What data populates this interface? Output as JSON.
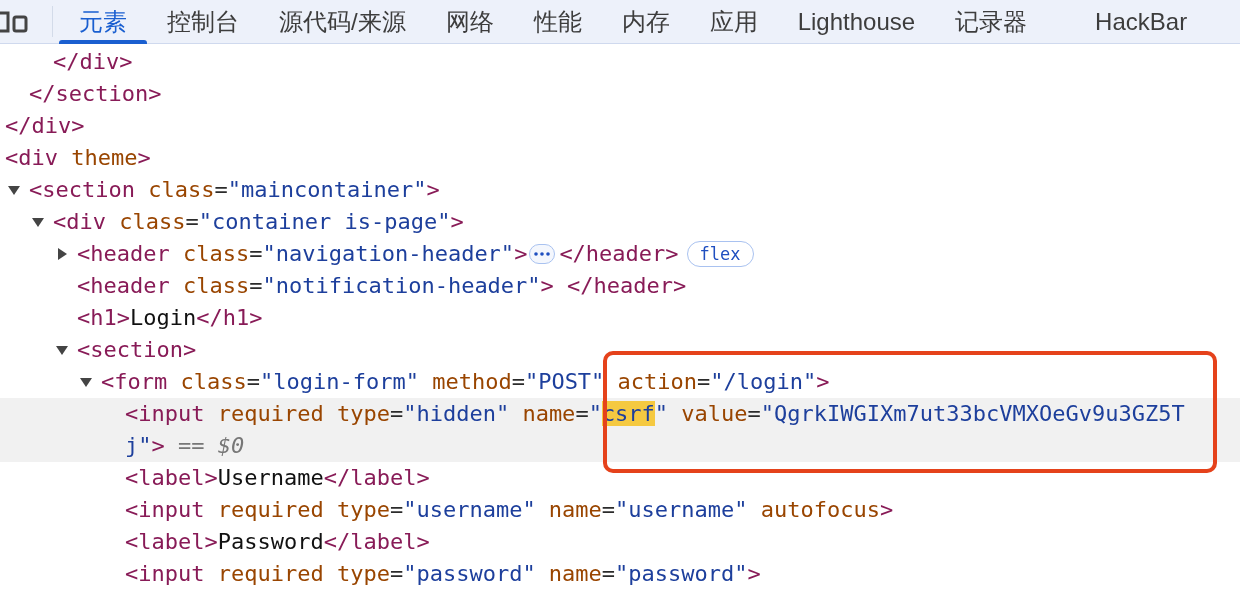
{
  "tabs": [
    {
      "label": "元素",
      "selected": true
    },
    {
      "label": "控制台",
      "selected": false
    },
    {
      "label": "源代码/来源",
      "selected": false
    },
    {
      "label": "网络",
      "selected": false
    },
    {
      "label": "性能",
      "selected": false
    },
    {
      "label": "内存",
      "selected": false
    },
    {
      "label": "应用",
      "selected": false
    },
    {
      "label": "Lighthouse",
      "selected": false
    },
    {
      "label": "记录器",
      "selected": false
    },
    {
      "label": "HackBar",
      "selected": false
    }
  ],
  "annotation_frame": {
    "kind": "rectangle"
  },
  "dom_tree": [
    {
      "children": [
        {
          "children": [
            {
              "selected": false,
              "tokens": [
                {
                  "kind": "tag",
                  "text": "</div>"
                }
              ]
            }
          ]
        },
        {
          "selected": false,
          "tokens": [
            {
              "kind": "tag",
              "text": "</section>"
            }
          ]
        }
      ]
    },
    {
      "selected": false,
      "tokens": [
        {
          "kind": "tag",
          "text": "</div>"
        }
      ]
    },
    {
      "selected": false,
      "tokens": [
        {
          "kind": "tag",
          "text": "<div"
        },
        {
          "kind": "attr",
          "text": " theme"
        },
        {
          "kind": "tag",
          "text": ">"
        }
      ],
      "children": [
        {
          "selected": false,
          "expanded": true,
          "tokens": [
            {
              "kind": "tag",
              "text": "<section"
            },
            {
              "kind": "attr",
              "text": " class"
            },
            {
              "kind": "punct",
              "text": "="
            },
            {
              "kind": "value",
              "text": "\"maincontainer\""
            },
            {
              "kind": "tag",
              "text": ">"
            }
          ],
          "children": [
            {
              "selected": false,
              "expanded": true,
              "tokens": [
                {
                  "kind": "tag",
                  "text": "<div"
                },
                {
                  "kind": "attr",
                  "text": " class"
                },
                {
                  "kind": "punct",
                  "text": "="
                },
                {
                  "kind": "value",
                  "text": "\"container is-page\""
                },
                {
                  "kind": "tag",
                  "text": ">"
                }
              ],
              "children": [
                {
                  "selected": false,
                  "expanded": false,
                  "tokens": [
                    {
                      "kind": "tag",
                      "text": "<header"
                    },
                    {
                      "kind": "attr",
                      "text": " class"
                    },
                    {
                      "kind": "punct",
                      "text": "="
                    },
                    {
                      "kind": "value",
                      "text": "\"navigation-header\""
                    },
                    {
                      "kind": "tag",
                      "text": ">"
                    },
                    {
                      "kind": "ellipsis"
                    },
                    {
                      "kind": "tag",
                      "text": "</header>"
                    },
                    {
                      "kind": "badge",
                      "text": "flex"
                    }
                  ]
                },
                {
                  "selected": false,
                  "tokens": [
                    {
                      "kind": "tag",
                      "text": "<header"
                    },
                    {
                      "kind": "attr",
                      "text": " class"
                    },
                    {
                      "kind": "punct",
                      "text": "="
                    },
                    {
                      "kind": "value",
                      "text": "\"notification-header\""
                    },
                    {
                      "kind": "tag",
                      "text": ">"
                    },
                    {
                      "kind": "tag",
                      "text": " </header>"
                    }
                  ]
                },
                {
                  "selected": false,
                  "tokens": [
                    {
                      "kind": "tag",
                      "text": "<h1>"
                    },
                    {
                      "kind": "text",
                      "text": "Login"
                    },
                    {
                      "kind": "tag",
                      "text": "</h1>"
                    }
                  ]
                },
                {
                  "selected": false,
                  "expanded": true,
                  "tokens": [
                    {
                      "kind": "tag",
                      "text": "<section>"
                    }
                  ],
                  "children": [
                    {
                      "selected": false,
                      "expanded": true,
                      "tokens": [
                        {
                          "kind": "tag",
                          "text": "<form"
                        },
                        {
                          "kind": "attr",
                          "text": " class"
                        },
                        {
                          "kind": "punct",
                          "text": "="
                        },
                        {
                          "kind": "value",
                          "text": "\"login-form\""
                        },
                        {
                          "kind": "attr",
                          "text": " method"
                        },
                        {
                          "kind": "punct",
                          "text": "="
                        },
                        {
                          "kind": "value",
                          "text": "\"POST\""
                        },
                        {
                          "kind": "attr",
                          "text": " action"
                        },
                        {
                          "kind": "punct",
                          "text": "="
                        },
                        {
                          "kind": "value",
                          "text": "\"/login\""
                        },
                        {
                          "kind": "tag",
                          "text": ">"
                        }
                      ],
                      "children": [
                        {
                          "selected": true,
                          "tokens": [
                            {
                              "kind": "tag",
                              "text": "<input"
                            },
                            {
                              "kind": "attr",
                              "text": " required type"
                            },
                            {
                              "kind": "punct",
                              "text": "="
                            },
                            {
                              "kind": "value",
                              "text": "\"hidden\""
                            },
                            {
                              "kind": "attr",
                              "text": " name"
                            },
                            {
                              "kind": "punct",
                              "text": "="
                            },
                            {
                              "kind": "value",
                              "text": "\""
                            },
                            {
                              "kind": "match",
                              "text": "csrf"
                            },
                            {
                              "kind": "value",
                              "text": "\""
                            },
                            {
                              "kind": "attr",
                              "text": " value"
                            },
                            {
                              "kind": "punct",
                              "text": "="
                            },
                            {
                              "kind": "value",
                              "text": "\"QgrkIWGIXm7ut33bcVMXOeGv9u3GZ5Tj\""
                            },
                            {
                              "kind": "tag",
                              "text": ">"
                            },
                            {
                              "kind": "console_ref",
                              "text": " == $0"
                            }
                          ]
                        },
                        {
                          "selected": false,
                          "tokens": [
                            {
                              "kind": "tag",
                              "text": "<label>"
                            },
                            {
                              "kind": "text",
                              "text": "Username"
                            },
                            {
                              "kind": "tag",
                              "text": "</label>"
                            }
                          ]
                        },
                        {
                          "selected": false,
                          "tokens": [
                            {
                              "kind": "tag",
                              "text": "<input"
                            },
                            {
                              "kind": "attr",
                              "text": " required type"
                            },
                            {
                              "kind": "punct",
                              "text": "="
                            },
                            {
                              "kind": "value",
                              "text": "\"username\""
                            },
                            {
                              "kind": "attr",
                              "text": " name"
                            },
                            {
                              "kind": "punct",
                              "text": "="
                            },
                            {
                              "kind": "value",
                              "text": "\"username\""
                            },
                            {
                              "kind": "attr",
                              "text": " autofocus"
                            },
                            {
                              "kind": "tag",
                              "text": ">"
                            }
                          ]
                        },
                        {
                          "selected": false,
                          "tokens": [
                            {
                              "kind": "tag",
                              "text": "<label>"
                            },
                            {
                              "kind": "text",
                              "text": "Password"
                            },
                            {
                              "kind": "tag",
                              "text": "</label>"
                            }
                          ]
                        },
                        {
                          "selected": false,
                          "tokens": [
                            {
                              "kind": "tag",
                              "text": "<input"
                            },
                            {
                              "kind": "attr",
                              "text": " required type"
                            },
                            {
                              "kind": "punct",
                              "text": "="
                            },
                            {
                              "kind": "value",
                              "text": "\"password\""
                            },
                            {
                              "kind": "attr",
                              "text": " name"
                            },
                            {
                              "kind": "punct",
                              "text": "="
                            },
                            {
                              "kind": "value",
                              "text": "\"password\""
                            },
                            {
                              "kind": "tag",
                              "text": ">"
                            }
                          ]
                        }
                      ]
                    }
                  ]
                }
              ]
            }
          ]
        }
      ]
    }
  ]
}
